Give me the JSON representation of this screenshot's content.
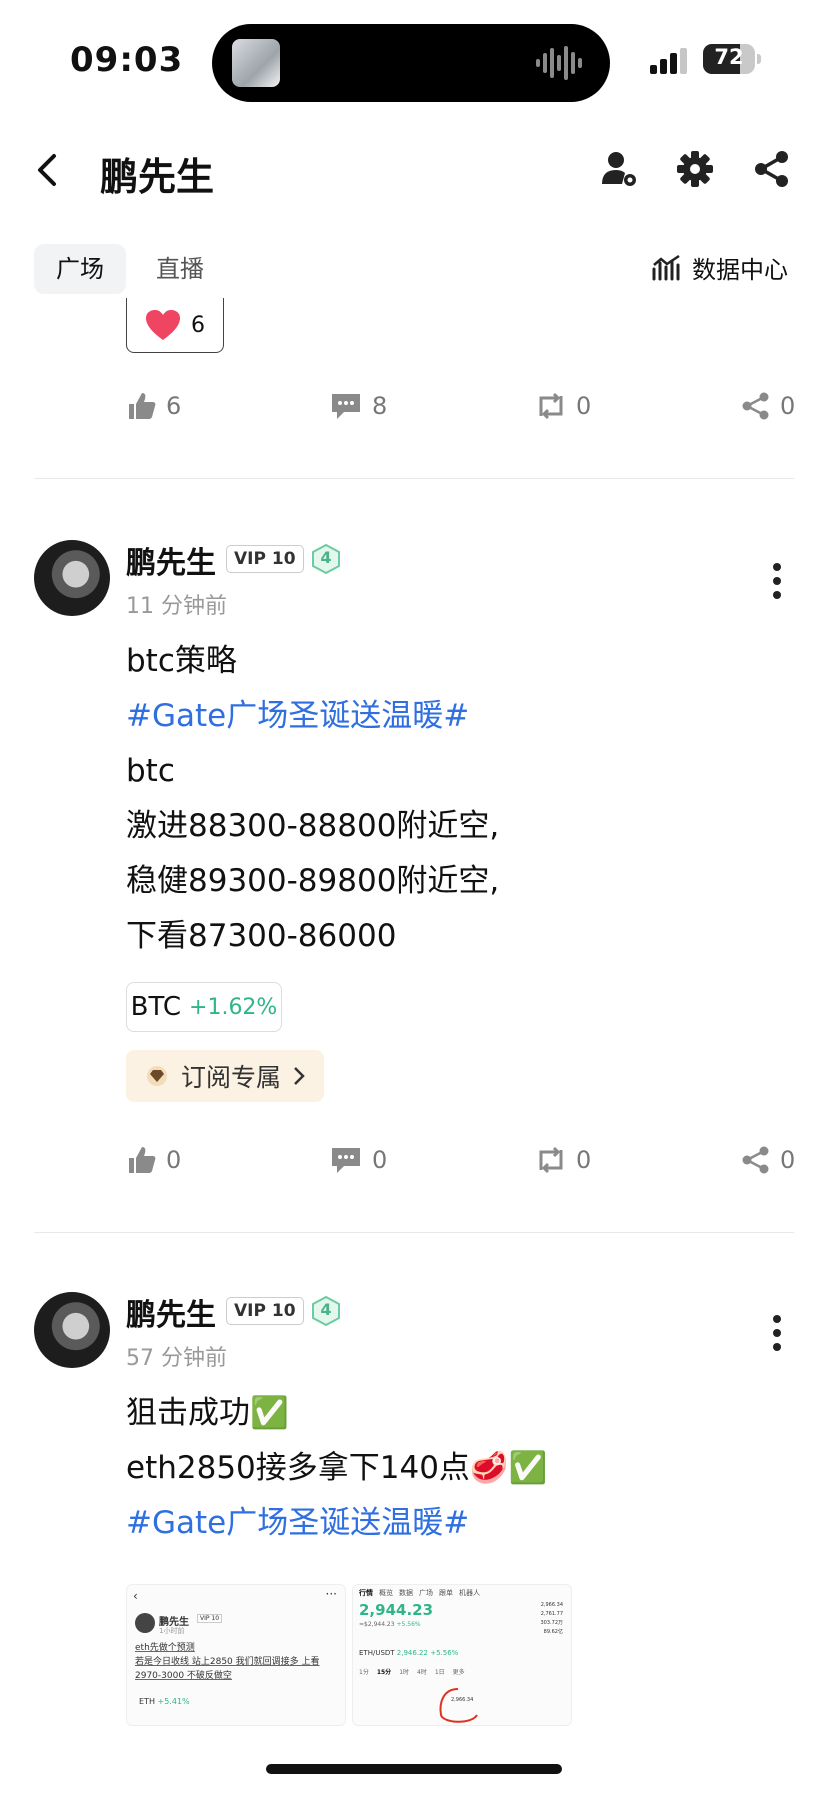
{
  "status_bar": {
    "time": "09:03",
    "battery": "72"
  },
  "header": {
    "title": "鹏先生"
  },
  "tabs": [
    {
      "label": "广场"
    },
    {
      "label": "直播"
    }
  ],
  "data_center": "数据中心",
  "prev_post": {
    "reaction_count": "6",
    "actions": {
      "likes": "6",
      "comments": "8",
      "reposts": "0",
      "shares": "0"
    }
  },
  "posts": [
    {
      "author": "鹏先生",
      "vip": "VIP 10",
      "level": "4",
      "time": "11 分钟前",
      "lines": [
        "btc策略",
        "#Gate广场圣诞送温暖#",
        "btc",
        "激进88300-88800附近空,",
        "稳健89300-89800附近空,",
        "下看87300-86000"
      ],
      "coin": {
        "symbol": "BTC",
        "change": "+1.62%"
      },
      "subscribe": "订阅专属",
      "actions": {
        "likes": "0",
        "comments": "0",
        "reposts": "0",
        "shares": "0"
      }
    },
    {
      "author": "鹏先生",
      "vip": "VIP 10",
      "level": "4",
      "time": "57 分钟前",
      "lines": [
        "狙击成功✅",
        "eth2850接多拿下140点🥩✅",
        "#Gate广场圣诞送温暖#"
      ],
      "images": [
        {
          "author": "鹏先生",
          "vip": "VIP 10",
          "time": "1小时前",
          "lines": [
            "eth先做个预测",
            "若是今日收线 站上2850 我们就回调接多 上看",
            "2970-3000 不破反做空"
          ],
          "coin": "ETH",
          "coin_change": "+5.41%"
        },
        {
          "tabs": [
            "行情",
            "概览",
            "数据",
            "广场",
            "跟单",
            "机器人"
          ],
          "price": "2,944.23",
          "sub_price": "≈$2,944.23",
          "change": "+5.56%",
          "high": "2,966.34",
          "low": "2,761.77",
          "vol": "303.72万",
          "amount": "89.62亿",
          "pair": "ETH/USDT",
          "pair_price": "2,946.22",
          "pair_change": "+5.56%",
          "intervals": [
            "1分",
            "15分",
            "1时",
            "4时",
            "1日",
            "更多"
          ],
          "level_mark": "2,966.34"
        }
      ]
    }
  ]
}
